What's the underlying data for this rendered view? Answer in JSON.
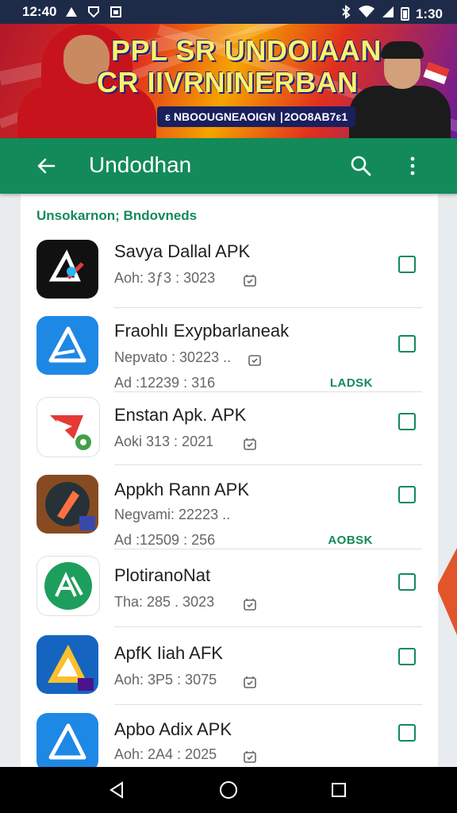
{
  "status_bar": {
    "time": "12:40",
    "clock_right": "1:30",
    "colors": {
      "bg": "#1d2b49"
    }
  },
  "banner": {
    "headline_1": "PPL SR UNDOIAAN",
    "headline_2": "CR IIVRNINERBAN",
    "subline": "ɛ NBOOUGNEAOIGN ∣2OO8AB7ɛ1"
  },
  "app_bar": {
    "title": "Undodhan",
    "icons": [
      "back-arrow-icon",
      "search-icon",
      "more-vert-icon"
    ],
    "color": "#138a5a"
  },
  "list": {
    "section_title": "Unsokarnon; Bndovneds",
    "items": [
      {
        "name": "Savya Dallal APK",
        "meta": "Aoh: 3ƒ3 : 3023",
        "meta2": "",
        "tag": "",
        "icon": "app-icon-black-logo",
        "icon_bg": "#111111"
      },
      {
        "name": "Fraohlı Exypbarlaneak",
        "meta": "Nepvato : 30223 ..",
        "meta2": "Ad :12239 : 316",
        "tag": "LADSK",
        "icon": "app-icon-blue-triangle",
        "icon_bg": "#1e88e5"
      },
      {
        "name": "Enstan Apk. APK",
        "meta": "Aoki 313 : 2021",
        "meta2": "",
        "tag": "",
        "icon": "app-icon-red-play",
        "icon_bg": "#ffffff"
      },
      {
        "name": "Appkh Rann APK",
        "meta": "Negvami: 22223 ..",
        "meta2": "Ad :12509 : 256",
        "tag": "AOBSK",
        "icon": "app-icon-dark-shield",
        "icon_bg": "#1e2a44"
      },
      {
        "name": "PlotiranoNat",
        "meta": "Tha: 285 . 3023",
        "meta2": "",
        "tag": "",
        "icon": "app-icon-green-circle",
        "icon_bg": "#ffffff"
      },
      {
        "name": "ApfK Iiah AFK",
        "meta": "Aoh: 3P5 : 3075",
        "meta2": "",
        "tag": "",
        "icon": "app-icon-blue-yellow",
        "icon_bg": "#1565c0"
      },
      {
        "name": "Apbo Adix APK",
        "meta": "Aoh: 2A4 : 2025",
        "meta2": "",
        "tag": "",
        "icon": "app-icon-blue-triangle",
        "icon_bg": "#1e88e5"
      }
    ]
  },
  "nav_bar": {
    "icons": [
      "back-triangle-icon",
      "home-circle-icon",
      "recents-square-icon"
    ]
  }
}
